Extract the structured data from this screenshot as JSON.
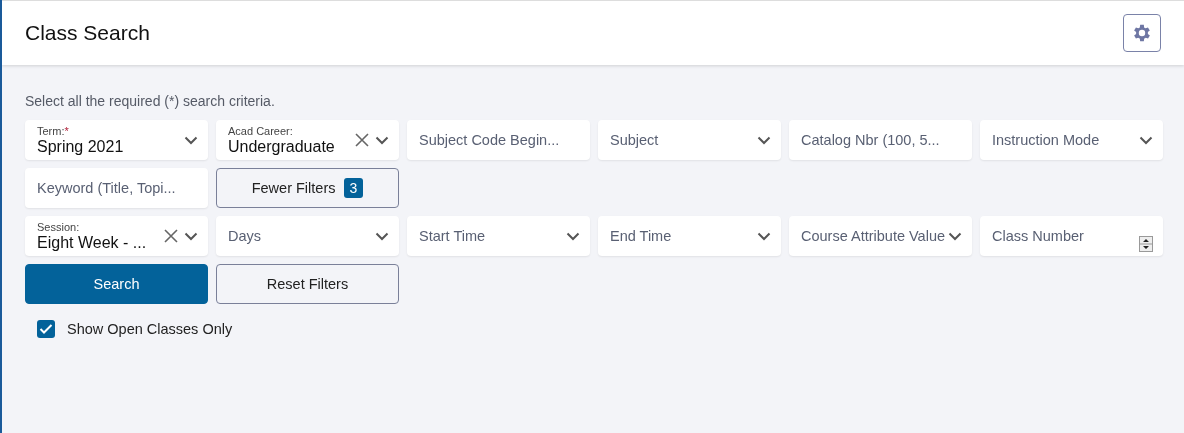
{
  "header": {
    "title": "Class Search"
  },
  "instructions": "Select all the required (*) search criteria.",
  "rows": [
    {
      "items": [
        {
          "kind": "select",
          "label": "Term:",
          "required_mark": "*",
          "value": "Spring 2021",
          "clearable": false
        },
        {
          "kind": "select",
          "label": "Acad Career:",
          "value": "Undergraduate",
          "clearable": true
        },
        {
          "kind": "text",
          "placeholder": "Subject Code Begin..."
        },
        {
          "kind": "select",
          "placeholder": "Subject",
          "clearable": false
        },
        {
          "kind": "text",
          "placeholder": "Catalog Nbr (100, 5..."
        },
        {
          "kind": "select",
          "placeholder": "Instruction Mode",
          "clearable": false
        }
      ]
    },
    {
      "items": [
        {
          "kind": "text",
          "placeholder": "Keyword (Title, Topi..."
        },
        {
          "kind": "button",
          "label": "Fewer Filters",
          "badge": "3"
        }
      ]
    },
    {
      "items": [
        {
          "kind": "select",
          "label": "Session:",
          "value": "Eight Week - ...",
          "clearable": true
        },
        {
          "kind": "select",
          "placeholder": "Days",
          "clearable": false
        },
        {
          "kind": "select",
          "placeholder": "Start Time",
          "clearable": false
        },
        {
          "kind": "select",
          "placeholder": "End Time",
          "clearable": false
        },
        {
          "kind": "select",
          "placeholder": "Course Attribute Value",
          "clearable": false
        },
        {
          "kind": "number",
          "placeholder": "Class Number"
        }
      ]
    },
    {
      "items": [
        {
          "kind": "primary_button",
          "label": "Search"
        },
        {
          "kind": "button",
          "label": "Reset Filters"
        }
      ]
    }
  ],
  "open_only": {
    "label": "Show Open Classes Only",
    "checked": true
  }
}
